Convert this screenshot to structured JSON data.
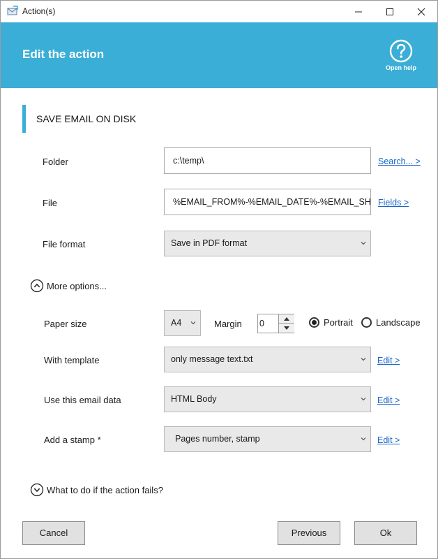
{
  "window": {
    "title": "Action(s)",
    "app_icon": "app-envelope-icon",
    "controls": [
      "minimize-icon",
      "maximize-icon",
      "close-icon"
    ]
  },
  "header": {
    "title": "Edit the action",
    "help_label": "Open help",
    "help_icon": "question-circle-icon",
    "background": "#3aaed6"
  },
  "section": {
    "title": "SAVE EMAIL ON DISK"
  },
  "form": {
    "folder": {
      "label": "Folder",
      "value": "c:\\temp\\",
      "link": "Search... >"
    },
    "file": {
      "label": "File",
      "value": "%EMAIL_FROM%-%EMAIL_DATE%-%EMAIL_SHO",
      "link": "Fields >"
    },
    "file_format": {
      "label": "File format",
      "value": "Save in PDF format"
    }
  },
  "more_options": {
    "label": "More options...",
    "paper_size": {
      "label": "Paper size",
      "value": "A4"
    },
    "margin": {
      "label": "Margin",
      "value": "0"
    },
    "orientation": {
      "portrait": "Portrait",
      "landscape": "Landscape",
      "selected": "Portrait"
    },
    "template": {
      "label": "With template",
      "value": "only message text.txt",
      "link": "Edit >"
    },
    "email_data": {
      "label": "Use this email data",
      "value": "HTML Body",
      "link": "Edit >"
    },
    "stamp": {
      "label": "Add a stamp *",
      "value": "Pages number, stamp",
      "link": "Edit >"
    }
  },
  "failure": {
    "label": "What to do if the action fails?"
  },
  "buttons": {
    "cancel": "Cancel",
    "previous": "Previous",
    "ok": "Ok"
  }
}
